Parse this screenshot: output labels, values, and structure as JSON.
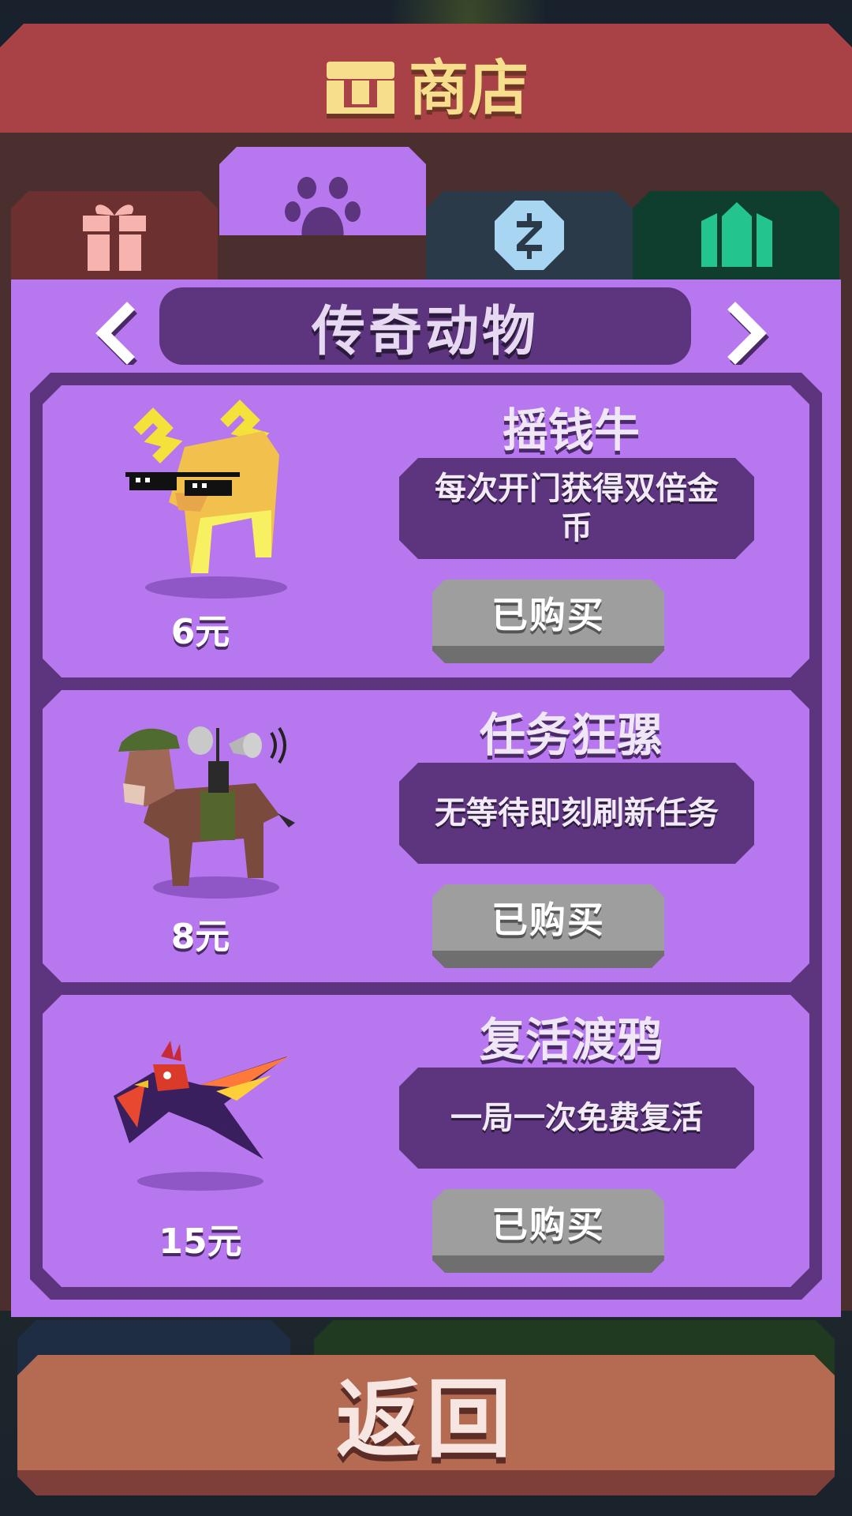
{
  "header": {
    "title": "商店"
  },
  "tabs": [
    {
      "id": "gift",
      "icon": "gift-icon",
      "active": false
    },
    {
      "id": "pets",
      "icon": "paw-icon",
      "active": true
    },
    {
      "id": "coins",
      "icon": "coin-icon",
      "active": false
    },
    {
      "id": "gems",
      "icon": "gem-icon",
      "active": false
    }
  ],
  "category": {
    "title": "传奇动物"
  },
  "items": [
    {
      "name": "摇钱牛",
      "description": "每次开门获得双倍金币",
      "price": "6元",
      "button": "已购买",
      "art": "money-cow"
    },
    {
      "name": "任务狂骡",
      "description": "无等待即刻刷新任务",
      "price": "8元",
      "button": "已购买",
      "art": "mission-mule"
    },
    {
      "name": "复活渡鸦",
      "description": "一局一次免费复活",
      "price": "15元",
      "button": "已购买",
      "art": "revive-raven"
    }
  ],
  "footer": {
    "back_label": "返回"
  },
  "colors": {
    "title_bar": "#a94246",
    "content_bg": "#b777ee",
    "panel_dark": "#5d357e",
    "purchased_button": "#9e9e9e",
    "back_button": "#b56a52"
  }
}
